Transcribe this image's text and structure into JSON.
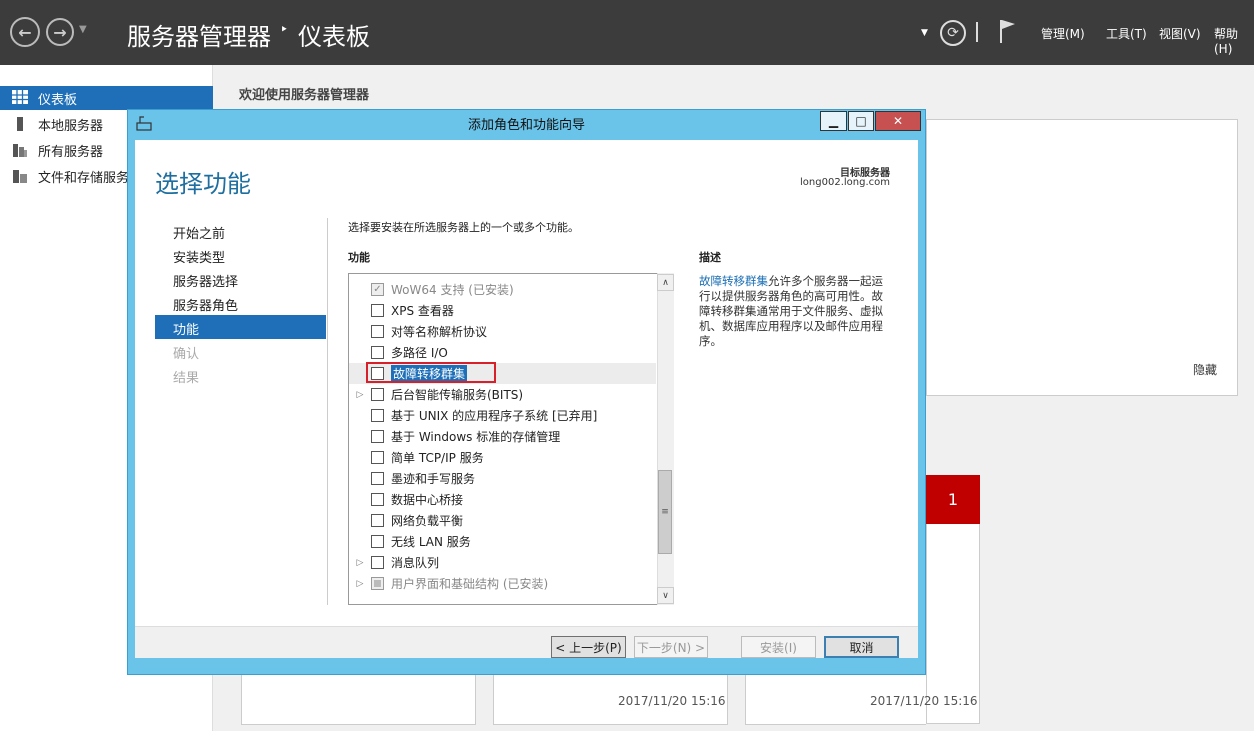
{
  "topbar": {
    "breadcrumb_root": "服务器管理器",
    "breadcrumb_sep": "‣",
    "breadcrumb_current": "仪表板",
    "menus": [
      "管理(M)",
      "工具(T)",
      "视图(V)",
      "帮助(H)"
    ]
  },
  "sidebar": {
    "items": [
      {
        "label": "仪表板",
        "icon": "dashboard-icon",
        "selected": true
      },
      {
        "label": "本地服务器",
        "icon": "server-icon"
      },
      {
        "label": "所有服务器",
        "icon": "servers-icon"
      },
      {
        "label": "文件和存储服务",
        "icon": "storage-icon"
      }
    ]
  },
  "main": {
    "welcome": "欢迎使用服务器管理器",
    "hide_label": "隐藏",
    "tile_count": "1",
    "timestamps": [
      "2017/11/20 15:16",
      "2017/11/20 15:16"
    ]
  },
  "dialog": {
    "title": "添加角色和功能向导",
    "heading": "选择功能",
    "target_label": "目标服务器",
    "target_value": "long002.long.com",
    "steps": [
      {
        "label": "开始之前",
        "state": "normal"
      },
      {
        "label": "安装类型",
        "state": "normal"
      },
      {
        "label": "服务器选择",
        "state": "normal"
      },
      {
        "label": "服务器角色",
        "state": "normal"
      },
      {
        "label": "功能",
        "state": "selected"
      },
      {
        "label": "确认",
        "state": "disabled"
      },
      {
        "label": "结果",
        "state": "disabled"
      }
    ],
    "instruction": "选择要安装在所选服务器上的一个或多个功能。",
    "features_header": "功能",
    "description_header": "描述",
    "description_link": "故障转移群集",
    "description_text": "允许多个服务器一起运行以提供服务器角色的高可用性。故障转移群集通常用于文件服务、虚拟机、数据库应用程序以及邮件应用程序。",
    "features": [
      {
        "label": "WoW64 支持 (已安装)",
        "checked": true,
        "disabled": true,
        "expander": false
      },
      {
        "label": "XPS 查看器",
        "checked": false,
        "expander": false
      },
      {
        "label": "对等名称解析协议",
        "checked": false,
        "expander": false
      },
      {
        "label": "多路径 I/O",
        "checked": false,
        "expander": false
      },
      {
        "label": "故障转移群集",
        "checked": false,
        "expander": false,
        "selected": true
      },
      {
        "label": "后台智能传输服务(BITS)",
        "checked": false,
        "expander": true
      },
      {
        "label": "基于 UNIX 的应用程序子系统 [已弃用]",
        "checked": false,
        "expander": false
      },
      {
        "label": "基于 Windows 标准的存储管理",
        "checked": false,
        "expander": false
      },
      {
        "label": "简单 TCP/IP 服务",
        "checked": false,
        "expander": false
      },
      {
        "label": "墨迹和手写服务",
        "checked": false,
        "expander": false
      },
      {
        "label": "数据中心桥接",
        "checked": false,
        "expander": false
      },
      {
        "label": "网络负载平衡",
        "checked": false,
        "expander": false
      },
      {
        "label": "无线 LAN 服务",
        "checked": false,
        "expander": false
      },
      {
        "label": "消息队列",
        "checked": false,
        "expander": true
      },
      {
        "label": "用户界面和基础结构 (已安装)",
        "checked": true,
        "disabled": true,
        "expander": true,
        "partial": true
      }
    ],
    "buttons": {
      "prev": "< 上一步(P)",
      "next": "下一步(N) >",
      "install": "安装(I)",
      "cancel": "取消"
    }
  }
}
